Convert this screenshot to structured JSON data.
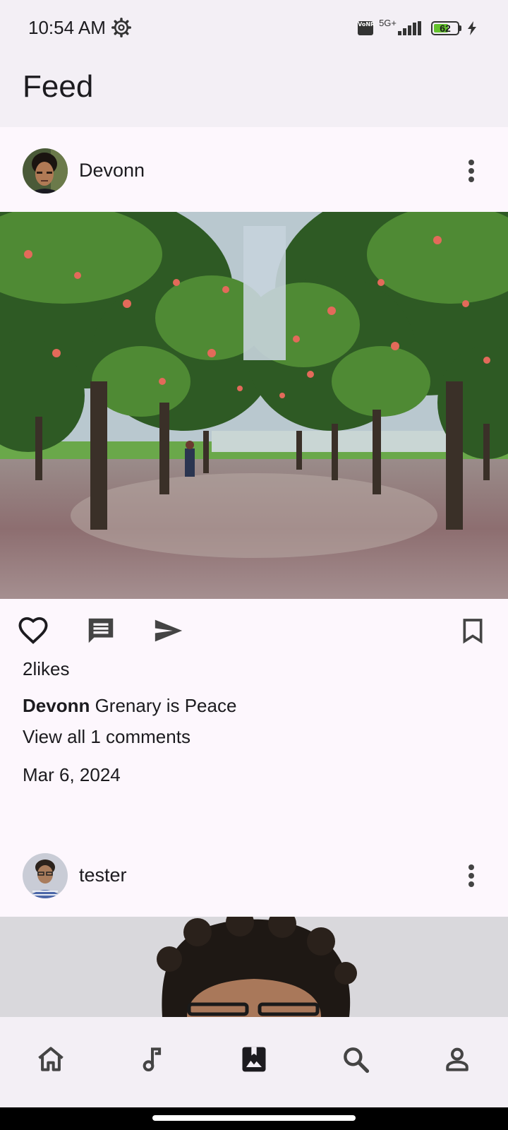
{
  "status_bar": {
    "time": "10:54 AM",
    "network_type": "5G+",
    "volte_label": "VoNR",
    "battery_percent": "62",
    "battery_level": 0.62,
    "icons": [
      "gear-icon",
      "signal-icon",
      "battery-icon",
      "charging-bolt-icon"
    ]
  },
  "app_bar": {
    "title": "Feed"
  },
  "posts": [
    {
      "username": "Devonn",
      "avatar": "avatar-devonn",
      "image": "tree-lined-park-path-photo",
      "likes_text": "2likes",
      "caption_user": "Devonn",
      "caption_text": " Grenary is Peace",
      "comments_text": "View all 1 comments",
      "date": "Mar 6, 2024"
    },
    {
      "username": "tester",
      "avatar": "avatar-tester",
      "image": "portrait-photo"
    }
  ],
  "post_actions": [
    "heart-icon",
    "comment-icon",
    "send-icon",
    "bookmark-icon"
  ],
  "bottom_nav": {
    "items": [
      "home-icon",
      "music-note-icon",
      "feed-photo-icon",
      "search-icon",
      "profile-icon"
    ],
    "active": "feed-photo-icon"
  },
  "colors": {
    "background": "#fdf7fd",
    "bars": "#f3eff5",
    "icon": "#444444",
    "text": "#1c1b1f",
    "battery": "#63c22c"
  }
}
